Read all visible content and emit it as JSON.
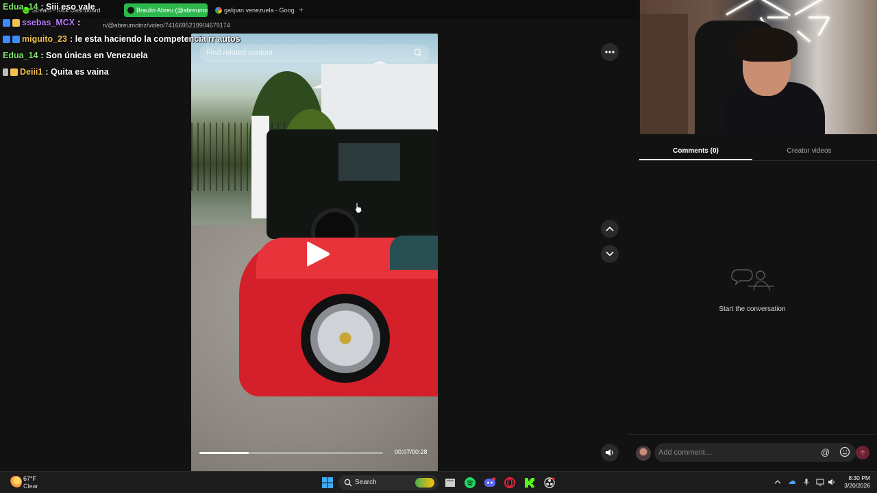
{
  "browser": {
    "tabs": [
      {
        "label": "Stream - Kick Dashboard",
        "active": false
      },
      {
        "label": "Braulio Abreu (@abreumo",
        "active": true
      },
      {
        "label": "galipan venezuela - Goog",
        "active": false
      }
    ],
    "new_tab_icon": "plus-icon",
    "url": "n/@abreumotriz/video/7416695219904679174"
  },
  "chat": {
    "messages": [
      {
        "user": "Edua_14",
        "text": ": Siii eso vale",
        "user_color": "#7ee36c"
      },
      {
        "user": "ssebas_MCX",
        "text": ":",
        "user_color": "#b77cff"
      },
      {
        "user": "miguito_23",
        "text": ": le esta haciendo la competencia rr autos",
        "user_color": "#f2c14e"
      },
      {
        "user": "Edua_14",
        "text": ": Son únicas en Venezuela",
        "user_color": "#7ee36c"
      },
      {
        "user": "Deiii1",
        "text": ": Quita es vaina",
        "user_color": "#f2c14e"
      }
    ]
  },
  "video": {
    "search_placeholder": "Find related content",
    "time": "00:07/00:28",
    "progress_fraction": 0.27,
    "play_icon": "play-icon"
  },
  "controls": {
    "more_icon": "more-icon",
    "prev_icon": "chevron-up-icon",
    "next_icon": "chevron-down-icon",
    "volume_icon": "volume-icon"
  },
  "panel": {
    "tab_comments": "Comments (0)",
    "tab_creator": "Creator videos",
    "empty_text": "Start the conversation",
    "comment_placeholder": "Add comment...",
    "at_label": "@"
  },
  "taskbar": {
    "temp": "67°F",
    "condition": "Clear",
    "search_label": "Search",
    "time": "8:30 PM",
    "date": "3/20/2026",
    "apps": [
      "windows-start-icon",
      "file-explorer-icon",
      "spotify-icon",
      "discord-icon",
      "opera-icon",
      "kick-icon",
      "obs-icon"
    ]
  },
  "colors": {
    "accent_green": "#2db84d",
    "send_button": "#6b2333",
    "background": "#121212"
  }
}
